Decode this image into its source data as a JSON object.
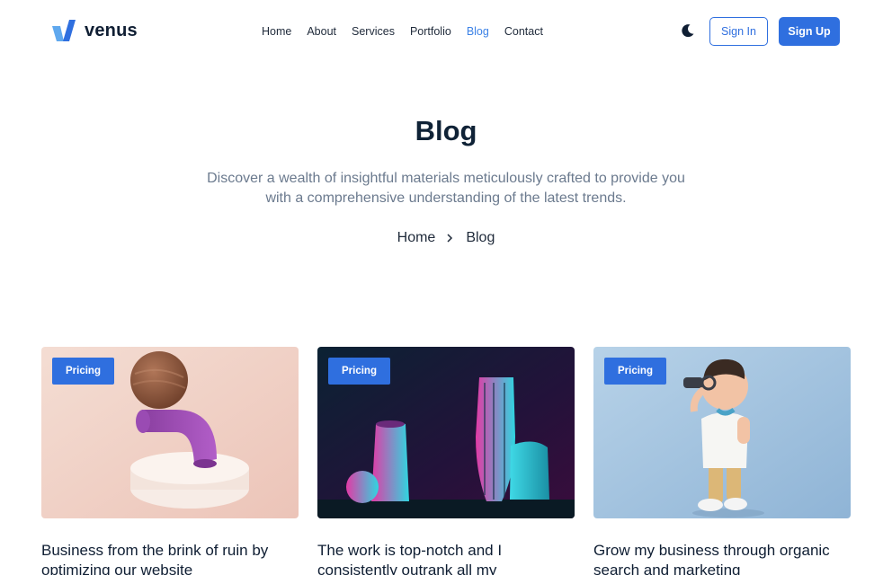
{
  "brand": {
    "name": "venus"
  },
  "nav": {
    "items": [
      {
        "label": "Home",
        "active": false
      },
      {
        "label": "About",
        "active": false
      },
      {
        "label": "Services",
        "active": false
      },
      {
        "label": "Portfolio",
        "active": false
      },
      {
        "label": "Blog",
        "active": true
      },
      {
        "label": "Contact",
        "active": false
      }
    ]
  },
  "header": {
    "theme_toggle_icon": "moon-icon",
    "signin_label": "Sign In",
    "signup_label": "Sign Up"
  },
  "hero": {
    "title": "Blog",
    "description": "Discover a wealth of insightful materials meticulously crafted to provide you with a comprehensive understanding of the latest trends.",
    "breadcrumb": {
      "home": "Home",
      "current": "Blog"
    }
  },
  "posts": [
    {
      "category": "Pricing",
      "title": "Business from the brink of ruin by optimizing our website"
    },
    {
      "category": "Pricing",
      "title": "The work is top-notch and I consistently outrank all my"
    },
    {
      "category": "Pricing",
      "title": "Grow my business through organic search and marketing"
    }
  ],
  "colors": {
    "accent": "#2f6fdf",
    "active_link": "#3c82e6",
    "heading": "#0f2236",
    "muted": "#6b7a8e"
  }
}
